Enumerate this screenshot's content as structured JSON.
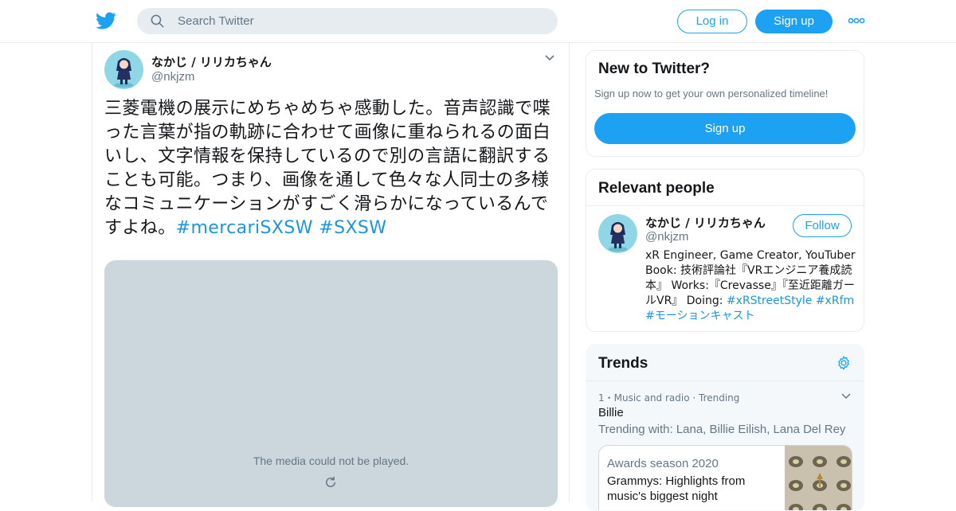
{
  "header": {
    "logo_icon": "twitter-bird-icon",
    "search_placeholder": "Search Twitter",
    "login_label": "Log in",
    "signup_label": "Sign up",
    "more_icon": "more-dots-icon",
    "accent_color": "#1da1f2"
  },
  "tweet": {
    "display_name": "なかじ / リリカちゃん",
    "handle": "@nkjzm",
    "text": "三菱電機の展示にめちゃめちゃ感動した。音声認識で喋った言葉が指の軌跡に合わせて画像に重ねられるの面白いし、文字情報を保持しているので別の言語に翻訳することも可能。つまり、画像を通して色々な人同士の多様なコミュニケーションがすごく滑らかになっているんですよね。",
    "hashtags": [
      "#mercariSXSW",
      "#SXSW"
    ],
    "media_message": "The media could not be played.",
    "hashtag_color": "#1b95e0"
  },
  "sidebar": {
    "new_to_twitter": {
      "title": "New to Twitter?",
      "subtitle": "Sign up now to get your own personalized timeline!",
      "signup_label": "Sign up"
    },
    "relevant_people": {
      "title": "Relevant people",
      "name": "なかじ / リリカちゃん",
      "handle": "@nkjzm",
      "follow_label": "Follow",
      "bio_text": "xR Engineer, Game Creator, YouTuber Book: 技術評論社『VRエンジニア養成読本』 Works:『Crevasse』『至近距離ガールVR』 Doing: ",
      "bio_hashtags": [
        "#xRStreetStyle",
        "#xRfm",
        "#モーションキャスト"
      ]
    },
    "trends": {
      "title": "Trends",
      "items": [
        {
          "meta": "1・Music and radio · Trending",
          "name": "Billie",
          "trending_with": "Trending with: Lana, Billie Eilish, Lana Del Rey"
        }
      ],
      "event": {
        "category": "Awards season 2020",
        "title": "Grammys: Highlights from music's biggest night"
      }
    }
  }
}
